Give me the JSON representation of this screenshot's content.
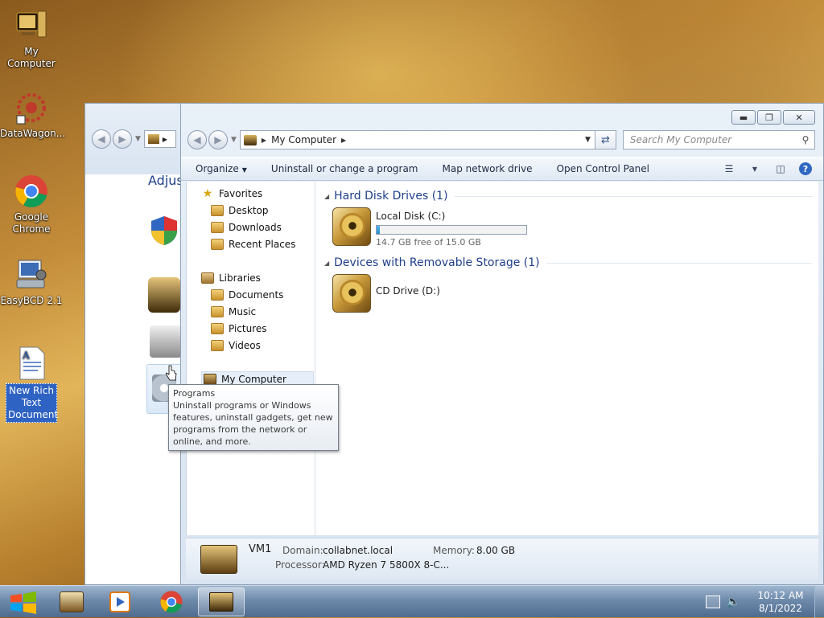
{
  "desktop": {
    "icons": [
      {
        "label": "My Computer",
        "icon": "computer-icon"
      },
      {
        "label": "DataWagon...",
        "icon": "datawagon-icon"
      },
      {
        "label": "Google Chrome",
        "icon": "chrome-icon"
      },
      {
        "label": "EasyBCD 2.1",
        "icon": "easybcd-icon"
      },
      {
        "label": "New Rich Text Document",
        "icon": "document-icon"
      }
    ]
  },
  "back_window": {
    "heading": "Adjus"
  },
  "window": {
    "address": {
      "crumb": "My Computer"
    },
    "search": {
      "placeholder": "Search My Computer"
    },
    "commands": {
      "organize": "Organize",
      "uninstall": "Uninstall or change a program",
      "map_drive": "Map network drive",
      "control_panel": "Open Control Panel"
    },
    "nav": {
      "favorites": "Favorites",
      "desktop": "Desktop",
      "downloads": "Downloads",
      "recent_places": "Recent Places",
      "libraries": "Libraries",
      "documents": "Documents",
      "music": "Music",
      "pictures": "Pictures",
      "videos": "Videos",
      "my_computer": "My Computer"
    },
    "groups": {
      "hard_disk": "Hard Disk Drives (1)",
      "removable": "Devices with Removable Storage (1)"
    },
    "drives": {
      "c": {
        "name": "Local Disk (C:)",
        "free": "14.7 GB free of 15.0 GB",
        "used_fraction": 0.02
      },
      "d": {
        "name": "CD Drive (D:)"
      }
    },
    "details": {
      "name": "VM1",
      "domain_label": "Domain:",
      "domain_value": "collabnet.local",
      "memory_label": "Memory:",
      "memory_value": "8.00 GB",
      "processor_label": "Processor:",
      "processor_value": "AMD Ryzen 7 5800X 8-C..."
    }
  },
  "tooltip": {
    "title": "Programs",
    "text": "Uninstall programs or Windows features, uninstall gadgets, get new programs from the network or online, and more."
  },
  "taskbar": {
    "clock_time": "10:12 AM",
    "clock_date": "8/1/2022"
  },
  "colors": {
    "accent": "#2f63c3",
    "group_heading": "#1e3f8a",
    "usage_bar": "#2a8ccc"
  }
}
